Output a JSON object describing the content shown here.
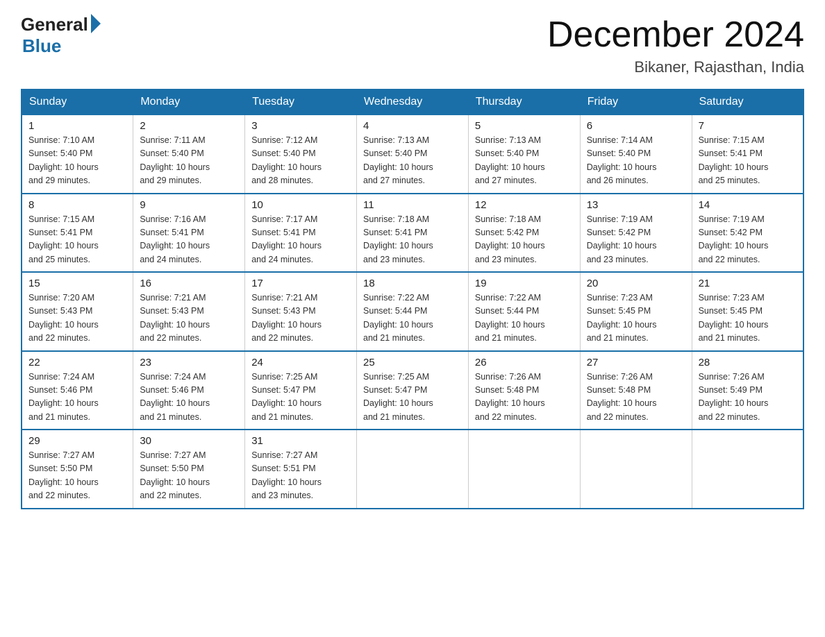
{
  "header": {
    "logo_general": "General",
    "logo_blue": "Blue",
    "month_title": "December 2024",
    "location": "Bikaner, Rajasthan, India"
  },
  "days_of_week": [
    "Sunday",
    "Monday",
    "Tuesday",
    "Wednesday",
    "Thursday",
    "Friday",
    "Saturday"
  ],
  "weeks": [
    [
      {
        "day": "1",
        "sunrise": "7:10 AM",
        "sunset": "5:40 PM",
        "daylight": "10 hours and 29 minutes."
      },
      {
        "day": "2",
        "sunrise": "7:11 AM",
        "sunset": "5:40 PM",
        "daylight": "10 hours and 29 minutes."
      },
      {
        "day": "3",
        "sunrise": "7:12 AM",
        "sunset": "5:40 PM",
        "daylight": "10 hours and 28 minutes."
      },
      {
        "day": "4",
        "sunrise": "7:13 AM",
        "sunset": "5:40 PM",
        "daylight": "10 hours and 27 minutes."
      },
      {
        "day": "5",
        "sunrise": "7:13 AM",
        "sunset": "5:40 PM",
        "daylight": "10 hours and 27 minutes."
      },
      {
        "day": "6",
        "sunrise": "7:14 AM",
        "sunset": "5:40 PM",
        "daylight": "10 hours and 26 minutes."
      },
      {
        "day": "7",
        "sunrise": "7:15 AM",
        "sunset": "5:41 PM",
        "daylight": "10 hours and 25 minutes."
      }
    ],
    [
      {
        "day": "8",
        "sunrise": "7:15 AM",
        "sunset": "5:41 PM",
        "daylight": "10 hours and 25 minutes."
      },
      {
        "day": "9",
        "sunrise": "7:16 AM",
        "sunset": "5:41 PM",
        "daylight": "10 hours and 24 minutes."
      },
      {
        "day": "10",
        "sunrise": "7:17 AM",
        "sunset": "5:41 PM",
        "daylight": "10 hours and 24 minutes."
      },
      {
        "day": "11",
        "sunrise": "7:18 AM",
        "sunset": "5:41 PM",
        "daylight": "10 hours and 23 minutes."
      },
      {
        "day": "12",
        "sunrise": "7:18 AM",
        "sunset": "5:42 PM",
        "daylight": "10 hours and 23 minutes."
      },
      {
        "day": "13",
        "sunrise": "7:19 AM",
        "sunset": "5:42 PM",
        "daylight": "10 hours and 23 minutes."
      },
      {
        "day": "14",
        "sunrise": "7:19 AM",
        "sunset": "5:42 PM",
        "daylight": "10 hours and 22 minutes."
      }
    ],
    [
      {
        "day": "15",
        "sunrise": "7:20 AM",
        "sunset": "5:43 PM",
        "daylight": "10 hours and 22 minutes."
      },
      {
        "day": "16",
        "sunrise": "7:21 AM",
        "sunset": "5:43 PM",
        "daylight": "10 hours and 22 minutes."
      },
      {
        "day": "17",
        "sunrise": "7:21 AM",
        "sunset": "5:43 PM",
        "daylight": "10 hours and 22 minutes."
      },
      {
        "day": "18",
        "sunrise": "7:22 AM",
        "sunset": "5:44 PM",
        "daylight": "10 hours and 21 minutes."
      },
      {
        "day": "19",
        "sunrise": "7:22 AM",
        "sunset": "5:44 PM",
        "daylight": "10 hours and 21 minutes."
      },
      {
        "day": "20",
        "sunrise": "7:23 AM",
        "sunset": "5:45 PM",
        "daylight": "10 hours and 21 minutes."
      },
      {
        "day": "21",
        "sunrise": "7:23 AM",
        "sunset": "5:45 PM",
        "daylight": "10 hours and 21 minutes."
      }
    ],
    [
      {
        "day": "22",
        "sunrise": "7:24 AM",
        "sunset": "5:46 PM",
        "daylight": "10 hours and 21 minutes."
      },
      {
        "day": "23",
        "sunrise": "7:24 AM",
        "sunset": "5:46 PM",
        "daylight": "10 hours and 21 minutes."
      },
      {
        "day": "24",
        "sunrise": "7:25 AM",
        "sunset": "5:47 PM",
        "daylight": "10 hours and 21 minutes."
      },
      {
        "day": "25",
        "sunrise": "7:25 AM",
        "sunset": "5:47 PM",
        "daylight": "10 hours and 21 minutes."
      },
      {
        "day": "26",
        "sunrise": "7:26 AM",
        "sunset": "5:48 PM",
        "daylight": "10 hours and 22 minutes."
      },
      {
        "day": "27",
        "sunrise": "7:26 AM",
        "sunset": "5:48 PM",
        "daylight": "10 hours and 22 minutes."
      },
      {
        "day": "28",
        "sunrise": "7:26 AM",
        "sunset": "5:49 PM",
        "daylight": "10 hours and 22 minutes."
      }
    ],
    [
      {
        "day": "29",
        "sunrise": "7:27 AM",
        "sunset": "5:50 PM",
        "daylight": "10 hours and 22 minutes."
      },
      {
        "day": "30",
        "sunrise": "7:27 AM",
        "sunset": "5:50 PM",
        "daylight": "10 hours and 22 minutes."
      },
      {
        "day": "31",
        "sunrise": "7:27 AM",
        "sunset": "5:51 PM",
        "daylight": "10 hours and 23 minutes."
      },
      null,
      null,
      null,
      null
    ]
  ],
  "labels": {
    "sunrise": "Sunrise:",
    "sunset": "Sunset:",
    "daylight": "Daylight:"
  }
}
